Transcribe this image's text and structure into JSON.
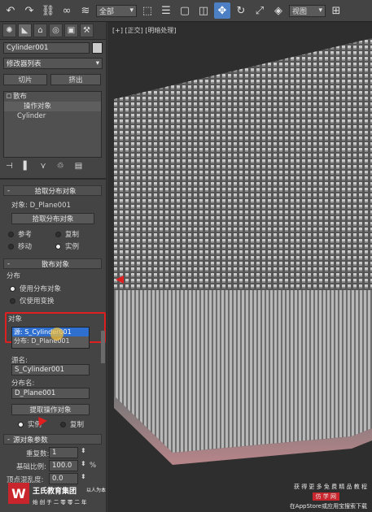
{
  "toolbar": {
    "selection_filter": "全部",
    "view_dropdown": "视图",
    "icons": [
      "undo-icon",
      "redo-icon",
      "link-icon",
      "unlink-icon",
      "bind-space-warp-icon",
      "select-icon",
      "select-by-name-icon",
      "rect-region-icon",
      "window-crossing-icon",
      "move-icon",
      "rotate-icon",
      "scale-icon",
      "snap-icon",
      "coord-icon"
    ]
  },
  "panel": {
    "object_name": "Cylinder001",
    "modifier_list": "修改器列表",
    "slice_button": "切片",
    "extrude_button": "挤出",
    "stack_items": [
      "散布",
      "操作对象",
      "Cylinder"
    ],
    "pick_rollout": {
      "title": "拾取分布对象",
      "object_label": "对象: D_Plane001",
      "pick_button": "拾取分布对象",
      "options": [
        "参考",
        "复制",
        "移动",
        "实例"
      ],
      "selected": "实例"
    },
    "scatter_rollout": {
      "title": "散布对象",
      "distribution_label": "分布",
      "options": [
        "使用分布对象",
        "仅使用变换"
      ],
      "selected": "使用分布对象",
      "objects_label": "对象",
      "objects_list": [
        "源: S_Cylinder001",
        "分布: D_Plane001"
      ],
      "source_name_label": "源名:",
      "source_name_value": "S_Cylinder001",
      "dist_name_label": "分布名:",
      "dist_name_value": "D_Plane001",
      "extract_button": "提取操作对象",
      "extract_options": [
        "实例",
        "复制"
      ],
      "extract_selected": "实例"
    },
    "source_params": {
      "title": "源对象参数",
      "duplicates_label": "重复数:",
      "duplicates_value": "1",
      "base_scale_label": "基础比例:",
      "base_scale_value": "100.0",
      "base_scale_unit": "%",
      "vertex_chaos_label": "顶点混乱度:",
      "vertex_chaos_value": "0.0"
    }
  },
  "viewport": {
    "label": "[+] [正交] [明暗处理]"
  },
  "watermark": {
    "logo_text": "王氏教育集团",
    "slogan": "以人为本",
    "subtitle": "始 创 于 二 零 零 二 年",
    "right_line1": "获 得 更 多 免 费 精 品 教 程",
    "right_line2": "仿 学 网",
    "right_line3": "在AppStore或应用宝搜索下载"
  },
  "colors": {
    "active_blue": "#4d7fc4",
    "highlight_red": "#e02020",
    "list_select": "#2f6fd0"
  }
}
